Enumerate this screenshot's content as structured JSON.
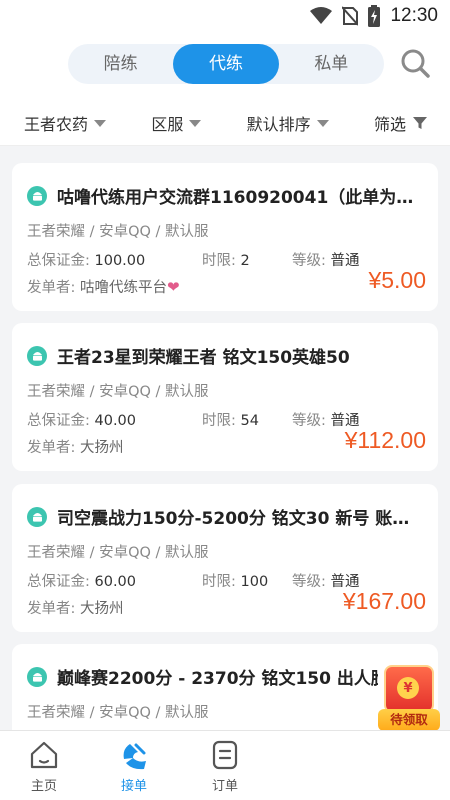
{
  "status_bar": {
    "time": "12:30"
  },
  "header": {
    "tabs": [
      {
        "label": "陪练",
        "active": false
      },
      {
        "label": "代练",
        "active": true
      },
      {
        "label": "私单",
        "active": false
      }
    ]
  },
  "filters": {
    "game": "王者农药",
    "server": "区服",
    "sort": "默认排序",
    "filter": "筛选"
  },
  "labels": {
    "deposit": "总保证金:",
    "time_limit": "时限:",
    "level": "等级:",
    "poster": "发单者:"
  },
  "orders": [
    {
      "title": "咕噜代练用户交流群1160920041（此单为…",
      "subtitle": "王者荣耀 / 安卓QQ / 默认服",
      "deposit": "100.00",
      "time_limit": "2",
      "level": "普通",
      "poster": "咕噜代练平台",
      "price": "¥5.00"
    },
    {
      "title": "王者23星到荣耀王者 铭文150英雄50",
      "subtitle": "王者荣耀 / 安卓QQ / 默认服",
      "deposit": "40.00",
      "time_limit": "54",
      "level": "普通",
      "poster": "大扬州",
      "price": "¥112.00"
    },
    {
      "title": "司空震战力150分-5200分 铭文30 新号 账…",
      "subtitle": "王者荣耀 / 安卓QQ / 默认服",
      "deposit": "60.00",
      "time_limit": "100",
      "level": "普通",
      "poster": "大扬州",
      "price": "¥167.00"
    },
    {
      "title": "巅峰赛2200分 - 2370分 铭文150 出人脸找",
      "subtitle": "王者荣耀 / 安卓QQ / 默认服"
    }
  ],
  "promo": {
    "label": "待领取",
    "coin": "¥"
  },
  "bottom_nav": {
    "items": [
      {
        "label": "主页",
        "icon": "home-icon",
        "active": false
      },
      {
        "label": "接单",
        "icon": "take-order-icon",
        "active": true
      },
      {
        "label": "订单",
        "icon": "order-list-icon",
        "active": false
      }
    ]
  },
  "colors": {
    "accent": "#1e93e8",
    "price": "#ee5a24",
    "android": "#3cc5b0"
  }
}
